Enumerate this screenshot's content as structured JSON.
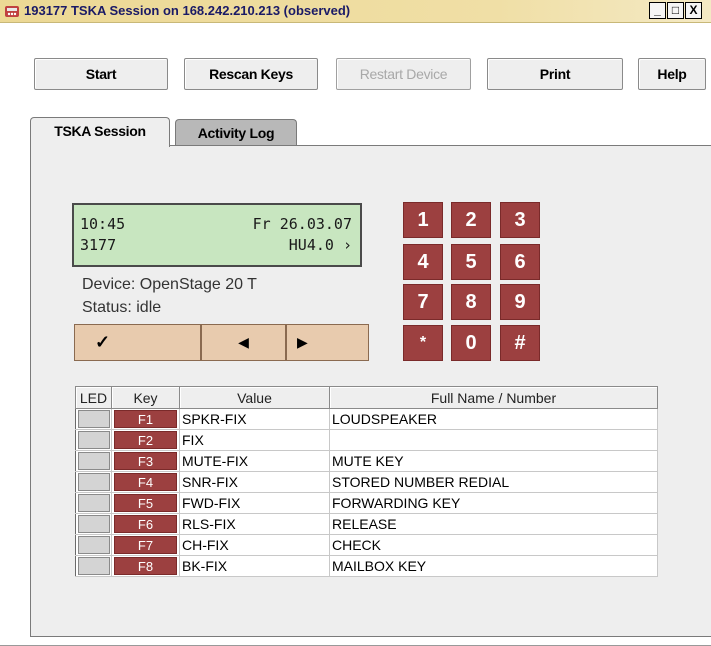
{
  "window": {
    "title": "193177 TSKA Session on 168.242.210.213 (observed)",
    "controls": [
      "_",
      "□",
      "X"
    ]
  },
  "toolbar": {
    "start": "Start",
    "rescan": "Rescan Keys",
    "restart": "Restart Device",
    "print": "Print",
    "help": "Help"
  },
  "tabs": {
    "session": "TSKA Session",
    "activity": "Activity Log"
  },
  "display": {
    "time": "10:45",
    "date": "Fr 26.03.07",
    "extension": "3177",
    "version": "HU4.0 ›"
  },
  "device": {
    "name": "Device: OpenStage 20 T",
    "status": "Status: idle"
  },
  "nav": {
    "ok": "✓",
    "left": "◀",
    "right": "▶"
  },
  "keypad": [
    "1",
    "2",
    "3",
    "4",
    "5",
    "6",
    "7",
    "8",
    "9",
    "*",
    "0",
    "#"
  ],
  "table": {
    "headers": [
      "LED",
      "Key",
      "Value",
      "Full Name / Number"
    ],
    "rows": [
      {
        "key": "F1",
        "value": "SPKR-FIX",
        "name": "LOUDSPEAKER"
      },
      {
        "key": "F2",
        "value": "FIX",
        "name": ""
      },
      {
        "key": "F3",
        "value": "MUTE-FIX",
        "name": "MUTE KEY"
      },
      {
        "key": "F4",
        "value": "SNR-FIX",
        "name": "STORED NUMBER REDIAL"
      },
      {
        "key": "F5",
        "value": "FWD-FIX",
        "name": "FORWARDING KEY"
      },
      {
        "key": "F6",
        "value": "RLS-FIX",
        "name": "RELEASE"
      },
      {
        "key": "F7",
        "value": "CH-FIX",
        "name": "CHECK"
      },
      {
        "key": "F8",
        "value": "BK-FIX",
        "name": "MAILBOX KEY"
      }
    ]
  },
  "colors": {
    "title_bar": "#ecd894",
    "lcd_background": "#c8e6c0",
    "key_red": "#9c4040",
    "nav_button": "#e8cbae"
  }
}
